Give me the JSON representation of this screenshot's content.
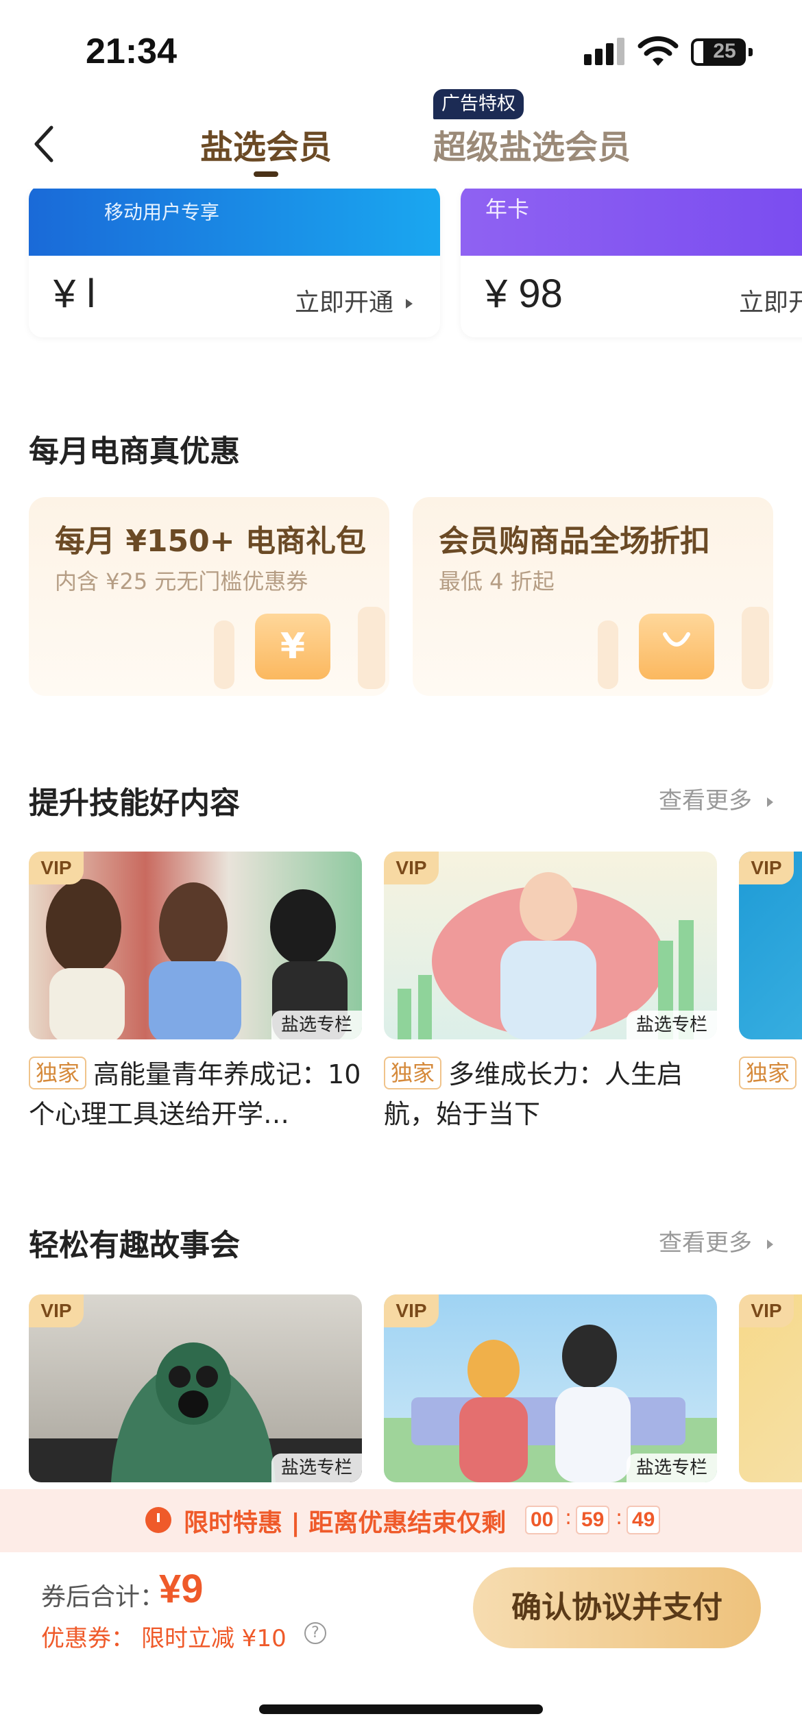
{
  "status": {
    "time": "21:34",
    "battery": "25"
  },
  "nav": {
    "tab_active": "盐选会员",
    "tab_other": "超级盐选会员",
    "ad_badge": "广告特权"
  },
  "top_cards": [
    {
      "subtitle": "移动用户专享",
      "price": "¥ l",
      "action": "立即开通"
    },
    {
      "subtitle": "年卡",
      "price": "¥ 98",
      "action": "立即开通"
    }
  ],
  "section_monthly": {
    "title": "每月电商真优惠",
    "cards": [
      {
        "title": "每月 ¥150+ 电商礼包",
        "subtitle": "内含 ¥25 元无门槛优惠券",
        "icon": "¥"
      },
      {
        "title": "会员购商品全场折扣",
        "subtitle": "最低 4 折起",
        "icon": ""
      }
    ]
  },
  "section_skills": {
    "title": "提升技能好内容",
    "more": "查看更多",
    "items": [
      {
        "vip": "VIP",
        "tag": "盐选专栏",
        "badge": "独家",
        "title": "高能量青年养成记：10个心理工具送给开学…"
      },
      {
        "vip": "VIP",
        "tag": "盐选专栏",
        "badge": "独家",
        "title": "多维成长力：人生启航，始于当下"
      },
      {
        "vip": "VIP",
        "tag": "",
        "badge": "独家",
        "title": ""
      }
    ]
  },
  "section_stories": {
    "title": "轻松有趣故事会",
    "more": "查看更多",
    "items": [
      {
        "vip": "VIP",
        "tag": "盐选专栏"
      },
      {
        "vip": "VIP",
        "tag": "盐选专栏"
      },
      {
        "vip": "VIP",
        "tag": ""
      }
    ]
  },
  "promo": {
    "text": "限时特惠 | 距离优惠结束仅剩",
    "hh": "00",
    "mm": "59",
    "ss": "49"
  },
  "pay": {
    "total_label": "券后合计：",
    "total_price": "¥9",
    "coupon_label": "优惠券：",
    "coupon_value": "限时立减 ¥10",
    "button": "确认协议并支付"
  }
}
